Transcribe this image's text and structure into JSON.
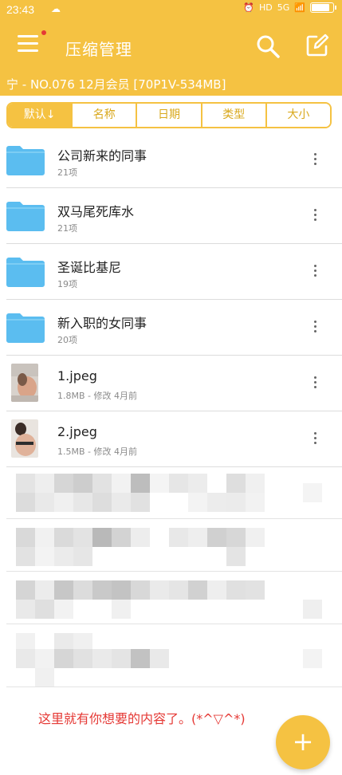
{
  "status_bar": {
    "time": "23:43",
    "network": "5G",
    "hd": "HD"
  },
  "app_bar": {
    "title": "压缩管理"
  },
  "path": "宁 - NO.076 12月会员 [70P1V-534MB]",
  "sort_tabs": [
    {
      "label": "默认↓",
      "active": true
    },
    {
      "label": "名称",
      "active": false
    },
    {
      "label": "日期",
      "active": false
    },
    {
      "label": "类型",
      "active": false
    },
    {
      "label": "大小",
      "active": false
    }
  ],
  "files": [
    {
      "name": "公司新来的同事",
      "meta": "21项",
      "kind": "folder"
    },
    {
      "name": "双马尾死库水",
      "meta": "21项",
      "kind": "folder"
    },
    {
      "name": "圣诞比基尼",
      "meta": "19项",
      "kind": "folder"
    },
    {
      "name": "新入职的女同事",
      "meta": "20项",
      "kind": "folder"
    },
    {
      "name": "1.jpeg",
      "meta": "1.8MB - 修改 4月前",
      "kind": "image"
    },
    {
      "name": "2.jpeg",
      "meta": "1.5MB - 修改 4月前",
      "kind": "image"
    }
  ],
  "footer_text": "这里就有你想要的内容了。(*^▽^*)",
  "fab_label": "+",
  "colors": {
    "accent": "#f5c242",
    "folder": "#5bbdf0",
    "footer_text": "#e53935"
  }
}
